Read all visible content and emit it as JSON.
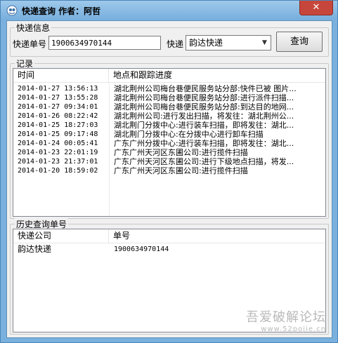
{
  "window": {
    "title": "快递查询 作者：阿哲",
    "close_glyph": "✕"
  },
  "express_info": {
    "group_label": "快递信息",
    "tracking_label": "快递单号",
    "tracking_value": "1900634970144",
    "courier_label": "快递",
    "courier_value": "韵达快递",
    "query_button": "查询"
  },
  "records": {
    "group_label": "记录",
    "columns": [
      "时间",
      "地点和跟踪进度"
    ],
    "rows": [
      {
        "time": "2014-01-27 13:56:13",
        "place": "湖北荆州公司梅台巷便民服务站分部:快件已被 图片..."
      },
      {
        "time": "2014-01-27 13:55:28",
        "place": "湖北荆州公司梅台巷便民服务站分部:进行派件扫描..."
      },
      {
        "time": "2014-01-27 09:34:01",
        "place": "湖北荆州公司梅台巷便民服务站分部:到达目的地网..."
      },
      {
        "time": "2014-01-26 08:22:42",
        "place": "湖北荆州公司:进行发出扫描，将发往：湖北荆州公..."
      },
      {
        "time": "2014-01-25 18:27:03",
        "place": "湖北荆门分拨中心:进行装车扫描，即将发往：湖北..."
      },
      {
        "time": "2014-01-25 09:17:48",
        "place": "湖北荆门分拨中心:在分拨中心进行卸车扫描"
      },
      {
        "time": "2014-01-24 00:05:41",
        "place": "广东广州分拨中心:进行装车扫描，即将发往：湖北..."
      },
      {
        "time": "2014-01-23 22:01:19",
        "place": "广东广州天河区东圃公司:进行揽件扫描"
      },
      {
        "time": "2014-01-23 21:37:01",
        "place": "广东广州天河区东圃公司:进行下级地点扫描，将发..."
      },
      {
        "time": "2014-01-20 18:59:02",
        "place": "广东广州天河区东圃公司:进行揽件扫描"
      }
    ]
  },
  "history": {
    "group_label": "历史查询单号",
    "columns": [
      "快递公司",
      "单号"
    ],
    "rows": [
      {
        "company": "韵达快递",
        "number": "1900634970144"
      }
    ]
  },
  "watermark": {
    "main": "吾爱破解论坛",
    "sub": "www.52pojie.cn"
  },
  "colors": {
    "title_gradient_top": "#9ec8ea",
    "title_gradient_bottom": "#79b0de",
    "close_button": "#c7463b",
    "client_background": "#f0f0f0"
  }
}
